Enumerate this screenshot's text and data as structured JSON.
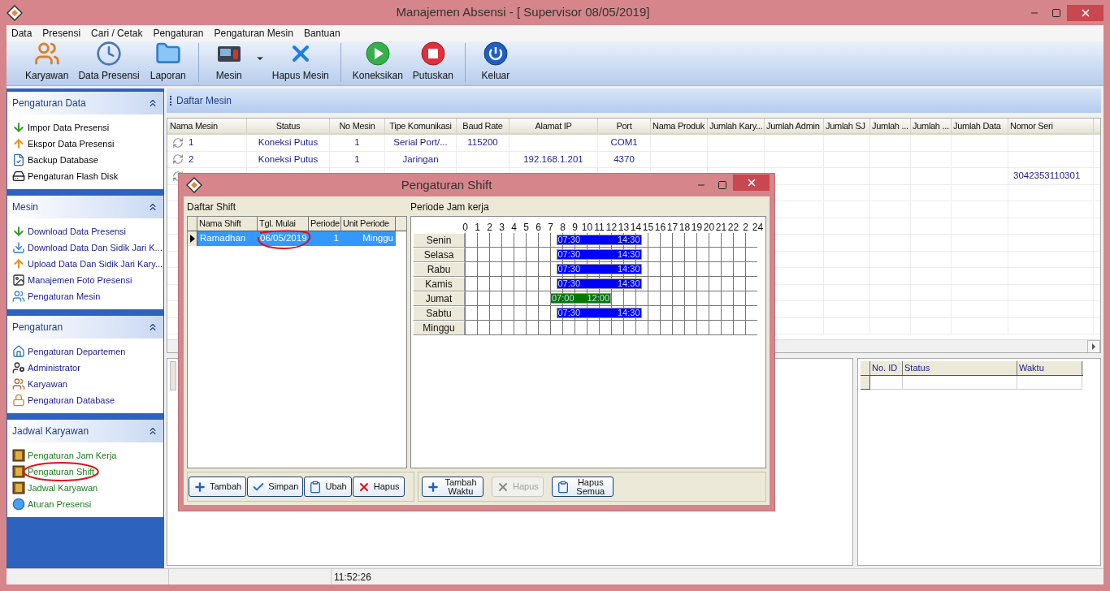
{
  "window": {
    "title": "Manajemen Absensi - [ Supervisor 08/05/2019]"
  },
  "menu": [
    "Data",
    "Presensi",
    "Cari / Cetak",
    "Pengaturan",
    "Pengaturan Mesin",
    "Bantuan"
  ],
  "toolbar": [
    [
      {
        "label": "Karyawan",
        "kind": "people"
      },
      {
        "label": "Data Presensi",
        "kind": "clock"
      },
      {
        "label": "Laporan",
        "kind": "folder"
      }
    ],
    [
      {
        "label": "Mesin",
        "kind": "machine"
      },
      {
        "kind": "dropdown"
      },
      {
        "label": "Hapus Mesin",
        "kind": "delete"
      }
    ],
    [
      {
        "label": "Koneksikan",
        "kind": "connect"
      },
      {
        "label": "Putuskan",
        "kind": "disconnect"
      }
    ],
    [
      {
        "label": "Keluar",
        "kind": "exit"
      }
    ]
  ],
  "sidebar": {
    "groups": [
      {
        "title": "Pengaturan Data",
        "color": "#000000",
        "items": [
          {
            "label": "Impor Data Presensi",
            "kind": "import"
          },
          {
            "label": "Ekspor Data Presensi",
            "kind": "export"
          },
          {
            "label": "Backup Database",
            "kind": "backup"
          },
          {
            "label": "Pengaturan Flash Disk",
            "kind": "flash"
          }
        ]
      },
      {
        "title": "Mesin",
        "color": "#1a1a8c",
        "items": [
          {
            "label": "Download Data Presensi",
            "kind": "import"
          },
          {
            "label": "Download Data Dan Sidik Jari K...",
            "kind": "download"
          },
          {
            "label": "Upload Data Dan Sidik Jari Kary...",
            "kind": "export"
          },
          {
            "label": "Manajemen Foto Presensi",
            "kind": "photo"
          },
          {
            "label": "Pengaturan Mesin",
            "kind": "machines"
          }
        ]
      },
      {
        "title": "Pengaturan",
        "color": "#1a1a8c",
        "items": [
          {
            "label": "Pengaturan Departemen",
            "kind": "department"
          },
          {
            "label": "Administrator",
            "kind": "admin"
          },
          {
            "label": "Karyawan",
            "kind": "people"
          },
          {
            "label": "Pengaturan Database",
            "kind": "lock"
          }
        ]
      },
      {
        "title": "Jadwal Karyawan",
        "color": "#1e7a1e",
        "items": [
          {
            "label": "Pengaturan Jam Kerja",
            "kind": "one"
          },
          {
            "label": "Pengaturan Shift",
            "kind": "two"
          },
          {
            "label": "Jadwal Karyawan",
            "kind": "three"
          },
          {
            "label": "Aturan Presensi",
            "kind": "dot"
          }
        ]
      }
    ]
  },
  "main": {
    "title": "Daftar Mesin",
    "table": {
      "columns": [
        "Nama Mesin",
        "Status",
        "No Mesin",
        "Tipe Komunikasi",
        "Baud Rate",
        "Alamat IP",
        "Port",
        "Nama Produk",
        "Jumlah Kary...",
        "Jumlah Admin",
        "Jumlah SJ",
        "Jumlah ...",
        "Jumlah ...",
        "Jumlah Data",
        "Nomor Seri"
      ],
      "rows": [
        {
          "name": "1",
          "status": "Koneksi Putus",
          "no": "1",
          "comm": "Serial Port/...",
          "baud": "115200",
          "port": "COM1"
        },
        {
          "name": "2",
          "status": "Koneksi Putus",
          "no": "1",
          "comm": "Jaringan",
          "ip": "192.168.1.201",
          "port": "4370"
        },
        {
          "serial": "3042353110301"
        }
      ]
    }
  },
  "log_table": {
    "columns": [
      "No. ID",
      "Status",
      "Waktu"
    ]
  },
  "status_bar": {
    "time": "11:52:26"
  },
  "dialog": {
    "title": "Pengaturan Shift",
    "shift_list": {
      "title": "Daftar Shift",
      "columns": [
        "Nama Shift",
        "Tgl. Mulai",
        "Periode",
        "Unit Periode"
      ],
      "rows": [
        {
          "cells": [
            "Ramadhan",
            "06/05/2019",
            "1",
            "Minggu"
          ],
          "selected": true
        }
      ]
    },
    "schedule": {
      "title": "Periode Jam kerja",
      "hours": [
        "0",
        "1",
        "2",
        "3",
        "4",
        "5",
        "6",
        "7",
        "8",
        "9",
        "10",
        "11",
        "12",
        "13",
        "14",
        "15",
        "16",
        "17",
        "18",
        "19",
        "20",
        "21",
        "22",
        "2",
        "24"
      ],
      "days": [
        {
          "label": "Senin",
          "bars": [
            {
              "start": "07:30",
              "end": "14:30",
              "color": "#0000ff"
            }
          ]
        },
        {
          "label": "Selasa",
          "bars": [
            {
              "start": "07:30",
              "end": "14:30",
              "color": "#0000ff"
            }
          ]
        },
        {
          "label": "Rabu",
          "bars": [
            {
              "start": "07:30",
              "end": "14:30",
              "color": "#0000ff"
            }
          ]
        },
        {
          "label": "Kamis",
          "bars": [
            {
              "start": "07:30",
              "end": "14:30",
              "color": "#0000ff"
            }
          ]
        },
        {
          "label": "Jumat",
          "bars": [
            {
              "start": "07:00",
              "end": "12:00",
              "color": "#007a00"
            }
          ]
        },
        {
          "label": "Sabtu",
          "bars": [
            {
              "start": "07:30",
              "end": "14:30",
              "color": "#0000ff"
            }
          ]
        },
        {
          "label": "Minggu"
        }
      ]
    },
    "shift_buttons": [
      {
        "label": "Tambah",
        "kind": "add",
        "disabled": false
      },
      {
        "label": "Simpan",
        "kind": "save",
        "disabled": false
      },
      {
        "label": "Ubah",
        "kind": "edit",
        "disabled": false
      },
      {
        "label": "Hapus",
        "kind": "delete",
        "disabled": false
      }
    ],
    "time_buttons": [
      {
        "label": "Tambah Waktu",
        "kind": "add",
        "disabled": false
      },
      {
        "label": "Hapus",
        "kind": "delete",
        "disabled": true
      },
      {
        "label": "Hapus Semua",
        "kind": "edit",
        "disabled": false
      }
    ]
  }
}
